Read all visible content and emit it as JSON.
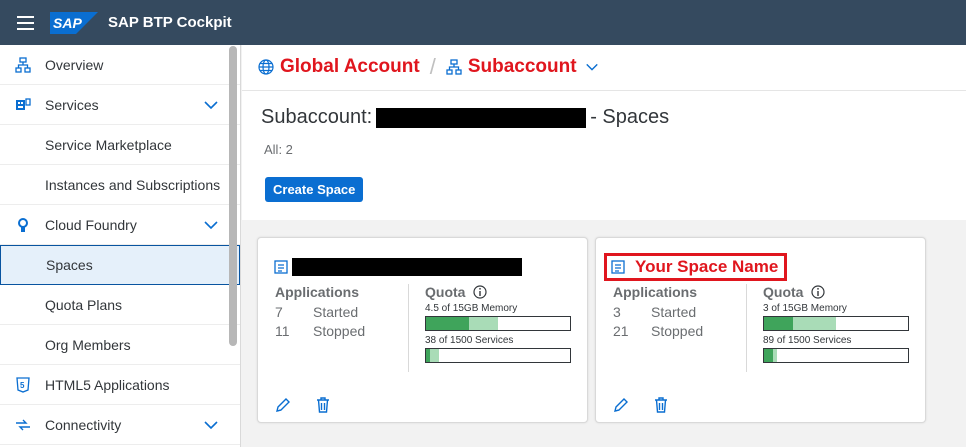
{
  "shell": {
    "logo_text": "SAP",
    "title": "SAP BTP Cockpit"
  },
  "sidebar": {
    "items": [
      {
        "label": "Overview",
        "icon": "hierarchy-icon",
        "level": 1,
        "expandable": false,
        "selected": false
      },
      {
        "label": "Services",
        "icon": "services-icon",
        "level": 1,
        "expandable": true,
        "selected": false
      },
      {
        "label": "Service Marketplace",
        "level": 2,
        "selected": false
      },
      {
        "label": "Instances and Subscriptions",
        "level": 2,
        "selected": false
      },
      {
        "label": "Cloud Foundry",
        "icon": "cloud-foundry-icon",
        "level": 1,
        "expandable": true,
        "selected": false
      },
      {
        "label": "Spaces",
        "level": 2,
        "selected": true
      },
      {
        "label": "Quota Plans",
        "level": 2,
        "selected": false
      },
      {
        "label": "Org Members",
        "level": 2,
        "selected": false
      },
      {
        "label": "HTML5 Applications",
        "icon": "html5-icon",
        "level": 1,
        "expandable": false,
        "selected": false
      },
      {
        "label": "Connectivity",
        "icon": "connectivity-icon",
        "level": 1,
        "expandable": true,
        "selected": false
      }
    ]
  },
  "breadcrumb": {
    "global": "Global Account",
    "sub": "Subaccount"
  },
  "page": {
    "title_prefix": "Subaccount:",
    "title_suffix": "- Spaces",
    "count": "All: 2",
    "create_label": "Create Space"
  },
  "cards": [
    {
      "name": "",
      "name_redacted": true,
      "apps_title": "Applications",
      "started_count": "7",
      "started_label": "Started",
      "stopped_count": "11",
      "stopped_label": "Stopped",
      "quota_title": "Quota",
      "memory_label": "4.5 of 15GB Memory",
      "memory_used_fraction": 0.3,
      "memory_allocated_fraction": 0.5,
      "services_label": "38 of 1500 Services",
      "services_used_fraction": 0.025,
      "services_allocated_fraction": 0.09
    },
    {
      "name": "Your Space Name",
      "name_redacted": false,
      "apps_title": "Applications",
      "started_count": "3",
      "started_label": "Started",
      "stopped_count": "21",
      "stopped_label": "Stopped",
      "quota_title": "Quota",
      "memory_label": "3 of 15GB Memory",
      "memory_used_fraction": 0.2,
      "memory_allocated_fraction": 0.5,
      "services_label": "89 of 1500 Services",
      "services_used_fraction": 0.06,
      "services_allocated_fraction": 0.09
    }
  ],
  "colors": {
    "shell": "#354a5f",
    "accent": "#0a6ed1",
    "highlight": "#e0161e",
    "used": "#3fa45b",
    "allocated": "#a9dcb7"
  }
}
